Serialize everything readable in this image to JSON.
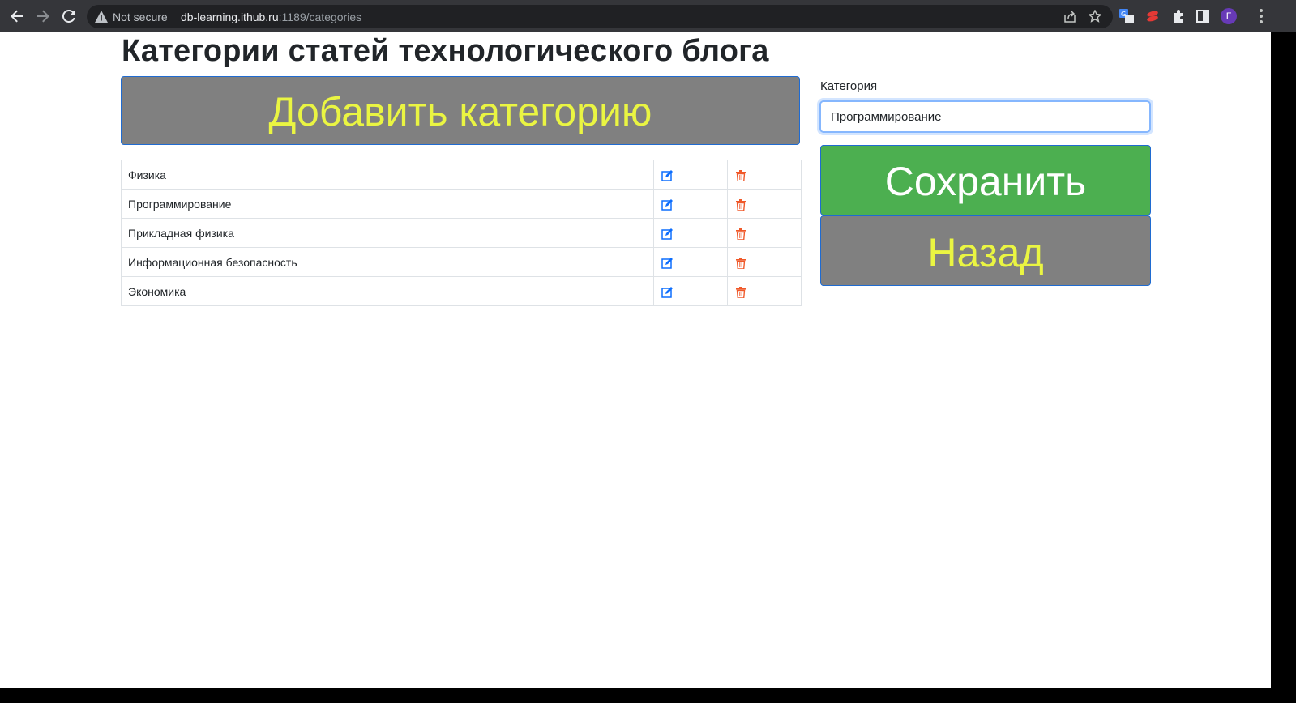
{
  "browser": {
    "security_label": "Not secure",
    "url_host": "db-learning.ithub.ru",
    "url_rest": ":1189/categories",
    "profile_initial": "Г"
  },
  "page": {
    "title": "Категории статей технологического блога",
    "add_button_label": "Добавить категорию",
    "categories": [
      {
        "name": "Физика"
      },
      {
        "name": "Программирование"
      },
      {
        "name": "Прикладная физика"
      },
      {
        "name": "Информационная безопасность"
      },
      {
        "name": "Экономика"
      }
    ],
    "icons": {
      "edit": "edit-icon",
      "delete": "trash-icon"
    },
    "colors": {
      "edit": "#0d6efd",
      "delete": "#f0592a",
      "add_text": "#eaf542",
      "save_bg": "#4caf50",
      "gray_btn": "#808080"
    }
  },
  "form": {
    "label": "Категория",
    "value": "Программирование",
    "save_label": "Сохранить",
    "back_label": "Назад"
  }
}
